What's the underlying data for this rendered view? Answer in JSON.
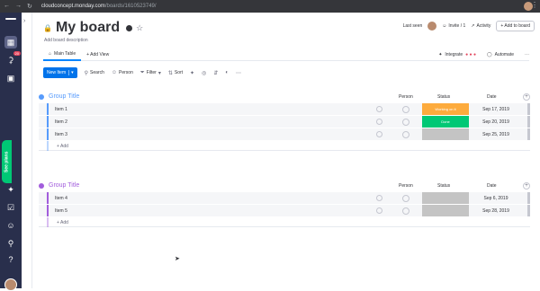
{
  "browser": {
    "url_domain": "cloudconcept.monday.com",
    "url_path": "/boards/1610523749/"
  },
  "leftrail": {
    "notifications_badge": "20",
    "see_plans_label": "See plans"
  },
  "board": {
    "title": "My board",
    "description": "Add board description"
  },
  "topright": {
    "last_seen_label": "Last seen",
    "invite_label": "Invite / 1",
    "activity_label": "Activity",
    "add_to_board_label": "+ Add to board"
  },
  "tabs": {
    "main_table": "Main Table",
    "add_view": "+ Add View",
    "integrate": "Integrate",
    "automate": "Automate"
  },
  "toolbar": {
    "new_item": "New Item",
    "search": "Search",
    "person": "Person",
    "filter": "Filter",
    "sort": "Sort"
  },
  "columns": {
    "person": "Person",
    "status": "Status",
    "date": "Date"
  },
  "groups": [
    {
      "title": "Group Title",
      "color": "#579bfc",
      "rows": [
        {
          "name": "Item 1",
          "status": "Working on it",
          "status_color": "#fdab3d",
          "date": "Sep 17, 2019"
        },
        {
          "name": "Item 2",
          "status": "Done",
          "status_color": "#00c875",
          "date": "Sep 20, 2019"
        },
        {
          "name": "Item 3",
          "status": "",
          "status_color": "#c4c4c4",
          "date": "Sep 25, 2019"
        }
      ],
      "add_label": "+ Add"
    },
    {
      "title": "Group Title",
      "color": "#a25ddc",
      "rows": [
        {
          "name": "Item 4",
          "status": "",
          "status_color": "#c4c4c4",
          "date": "Sep 6, 2019"
        },
        {
          "name": "Item 5",
          "status": "",
          "status_color": "#c4c4c4",
          "date": "Sep 28, 2019"
        }
      ],
      "add_label": "+ Add"
    }
  ]
}
